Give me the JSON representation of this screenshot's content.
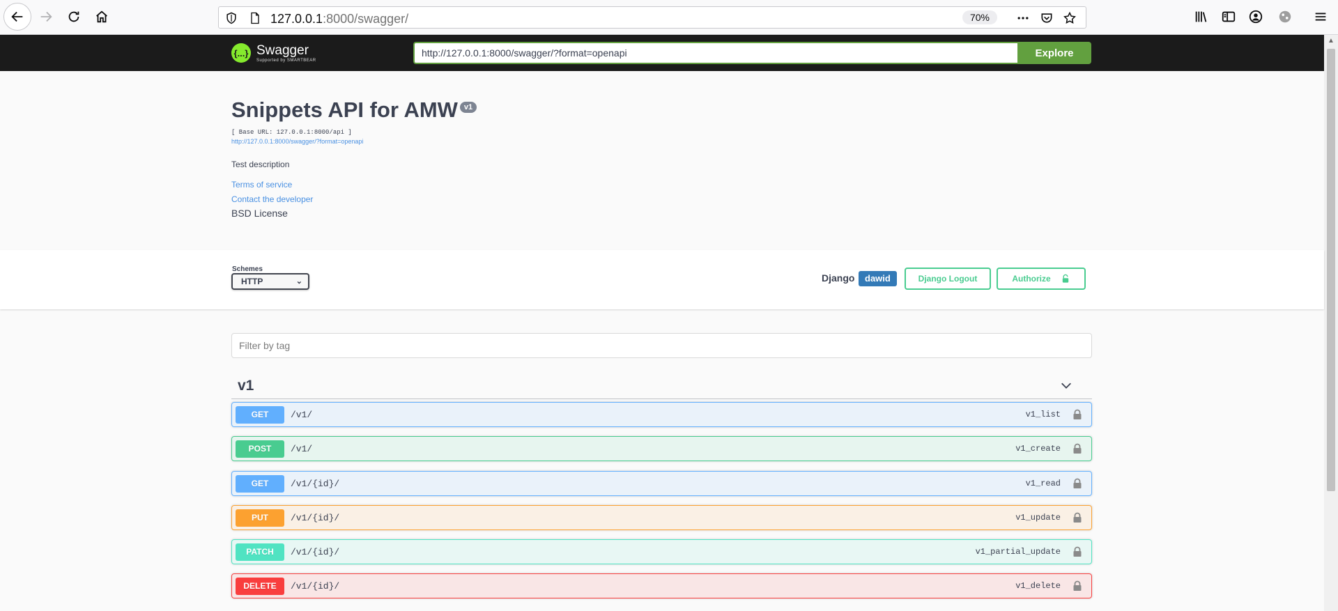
{
  "browser": {
    "url_host": "127.0.0.1",
    "url_rest": ":8000/swagger/",
    "zoom": "70%"
  },
  "topbar": {
    "logo_name": "Swagger",
    "logo_sub": "Supported by SMARTBEAR",
    "logo_mark": "{...}",
    "spec_url": "http://127.0.0.1:8000/swagger/?format=openapi",
    "explore_label": "Explore"
  },
  "info": {
    "title": "Snippets API for AMW",
    "version": "v1",
    "base_url": "[ Base URL: 127.0.0.1:8000/api ]",
    "spec_link": "http://127.0.0.1:8000/swagger/?format=openapi",
    "description": "Test description",
    "terms": "Terms of service",
    "contact": "Contact the developer",
    "license": "BSD License"
  },
  "schemes": {
    "label": "Schemes",
    "selected": "HTTP",
    "options": [
      "HTTP"
    ]
  },
  "auth": {
    "django_label": "Django",
    "username": "dawid",
    "logout_label": "Django Logout",
    "authorize_label": "Authorize"
  },
  "filter": {
    "placeholder": "Filter by tag"
  },
  "tag": {
    "name": "v1"
  },
  "operations": [
    {
      "method": "GET",
      "path": "/v1/",
      "operation_id": "v1_list"
    },
    {
      "method": "POST",
      "path": "/v1/",
      "operation_id": "v1_create"
    },
    {
      "method": "GET",
      "path": "/v1/{id}/",
      "operation_id": "v1_read"
    },
    {
      "method": "PUT",
      "path": "/v1/{id}/",
      "operation_id": "v1_update"
    },
    {
      "method": "PATCH",
      "path": "/v1/{id}/",
      "operation_id": "v1_partial_update"
    },
    {
      "method": "DELETE",
      "path": "/v1/{id}/",
      "operation_id": "v1_delete"
    }
  ],
  "colors": {
    "get": "#61affe",
    "post": "#49cc90",
    "put": "#fca130",
    "patch": "#50e3c2",
    "delete": "#f93e3e",
    "topbar": "#1b1b1b",
    "explore": "#62a03f",
    "link": "#4990e2"
  }
}
